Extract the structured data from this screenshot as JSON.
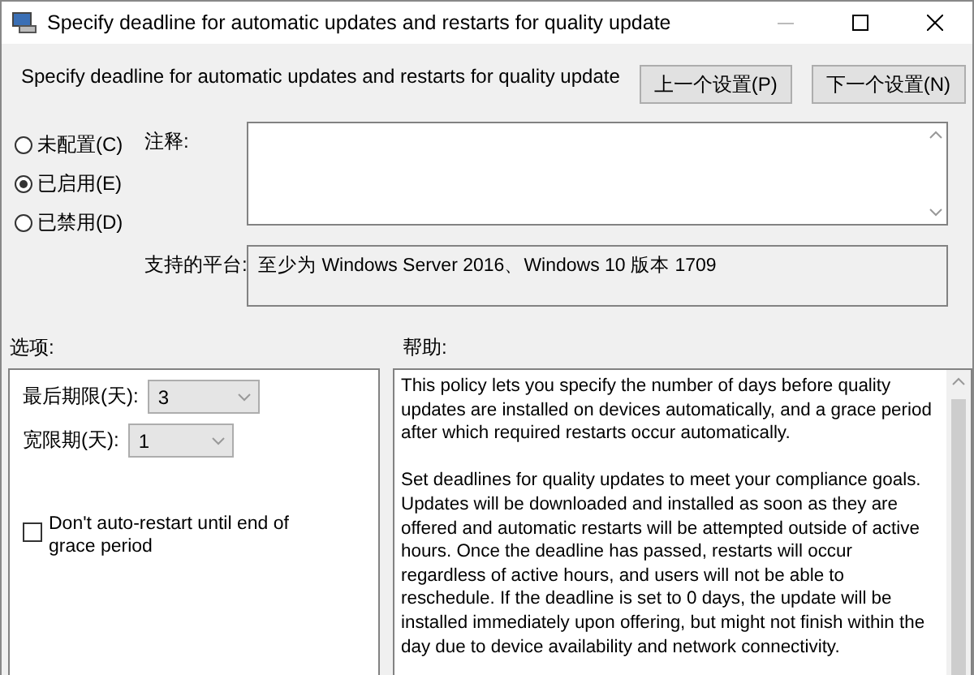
{
  "window": {
    "title": "Specify deadline for automatic updates and restarts for quality update"
  },
  "header": {
    "title": "Specify deadline for automatic updates and restarts for quality update"
  },
  "nav_buttons": [
    "上一个设置(P)",
    "下一个设置(N)"
  ],
  "radios": [
    {
      "label": "未配置(C)",
      "selected": false
    },
    {
      "label": "已启用(E)",
      "selected": true
    },
    {
      "label": "已禁用(D)",
      "selected": false
    }
  ],
  "comment": {
    "label": "注释:"
  },
  "platform": {
    "label": "支持的平台:",
    "value": "至少为 Windows Server 2016、Windows 10 版本 1709"
  },
  "options": {
    "label": "选项:",
    "items": [
      {
        "kind": "dropdown",
        "label": "最后期限(天):",
        "value": "3"
      },
      {
        "kind": "dropdown",
        "label": "宽限期(天):",
        "value": "1"
      },
      {
        "kind": "checkbox",
        "label": "Don't auto-restart until end of grace period",
        "checked": false
      }
    ]
  },
  "help": {
    "label": "帮助:",
    "paragraphs": [
      "This policy lets you specify the number of days before quality updates are installed on devices automatically, and a grace period after which required restarts occur automatically.",
      "Set deadlines for quality updates to meet your compliance goals. Updates will be downloaded and installed as soon as they are offered and automatic restarts will be attempted outside of active hours. Once the deadline has passed, restarts will occur regardless of active hours, and users will not be able to reschedule. If the deadline is set to 0 days, the update will be installed immediately upon offering, but might not finish within the day due to device availability and network connectivity."
    ]
  }
}
